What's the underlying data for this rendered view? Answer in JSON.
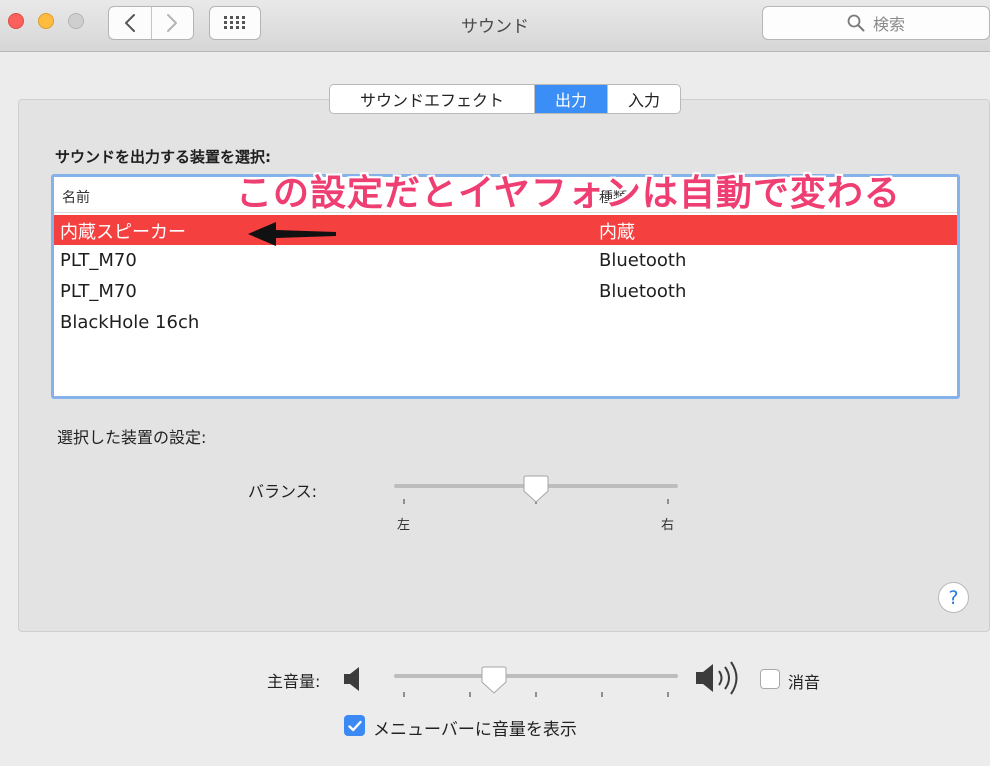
{
  "window": {
    "title": "サウンド"
  },
  "search": {
    "placeholder": "検索",
    "icon": "search-icon"
  },
  "tabs": [
    {
      "label": "サウンドエフェクト",
      "active": false
    },
    {
      "label": "出力",
      "active": true
    },
    {
      "label": "入力",
      "active": false
    }
  ],
  "output": {
    "heading": "サウンドを出力する装置を選択:",
    "columns": {
      "name": "名前",
      "type": "種類"
    },
    "devices": [
      {
        "name": "内蔵スピーカー",
        "type": "内蔵",
        "selected": true
      },
      {
        "name": "PLT_M70",
        "type": "Bluetooth",
        "selected": false
      },
      {
        "name": "PLT_M70",
        "type": "Bluetooth",
        "selected": false
      },
      {
        "name": "BlackHole 16ch",
        "type": "",
        "selected": false
      }
    ],
    "selected_color": "#f54040"
  },
  "annotation": {
    "text": "この設定だとイヤフォンは自動で変わる",
    "color": "#ef3e72"
  },
  "device_settings": {
    "label": "選択した装置の設定:",
    "balance": {
      "label": "バランス:",
      "left": "左",
      "right": "右",
      "value": 0.5
    }
  },
  "help": {
    "label": "?"
  },
  "volume": {
    "label": "主音量:",
    "value": 0.34,
    "mute_label": "消音",
    "muted": false
  },
  "menubar_option": {
    "label": "メニューバーに音量を表示",
    "checked": true
  },
  "colors": {
    "accent": "#3a8ef6",
    "highlight_border": "#85b2ea"
  }
}
